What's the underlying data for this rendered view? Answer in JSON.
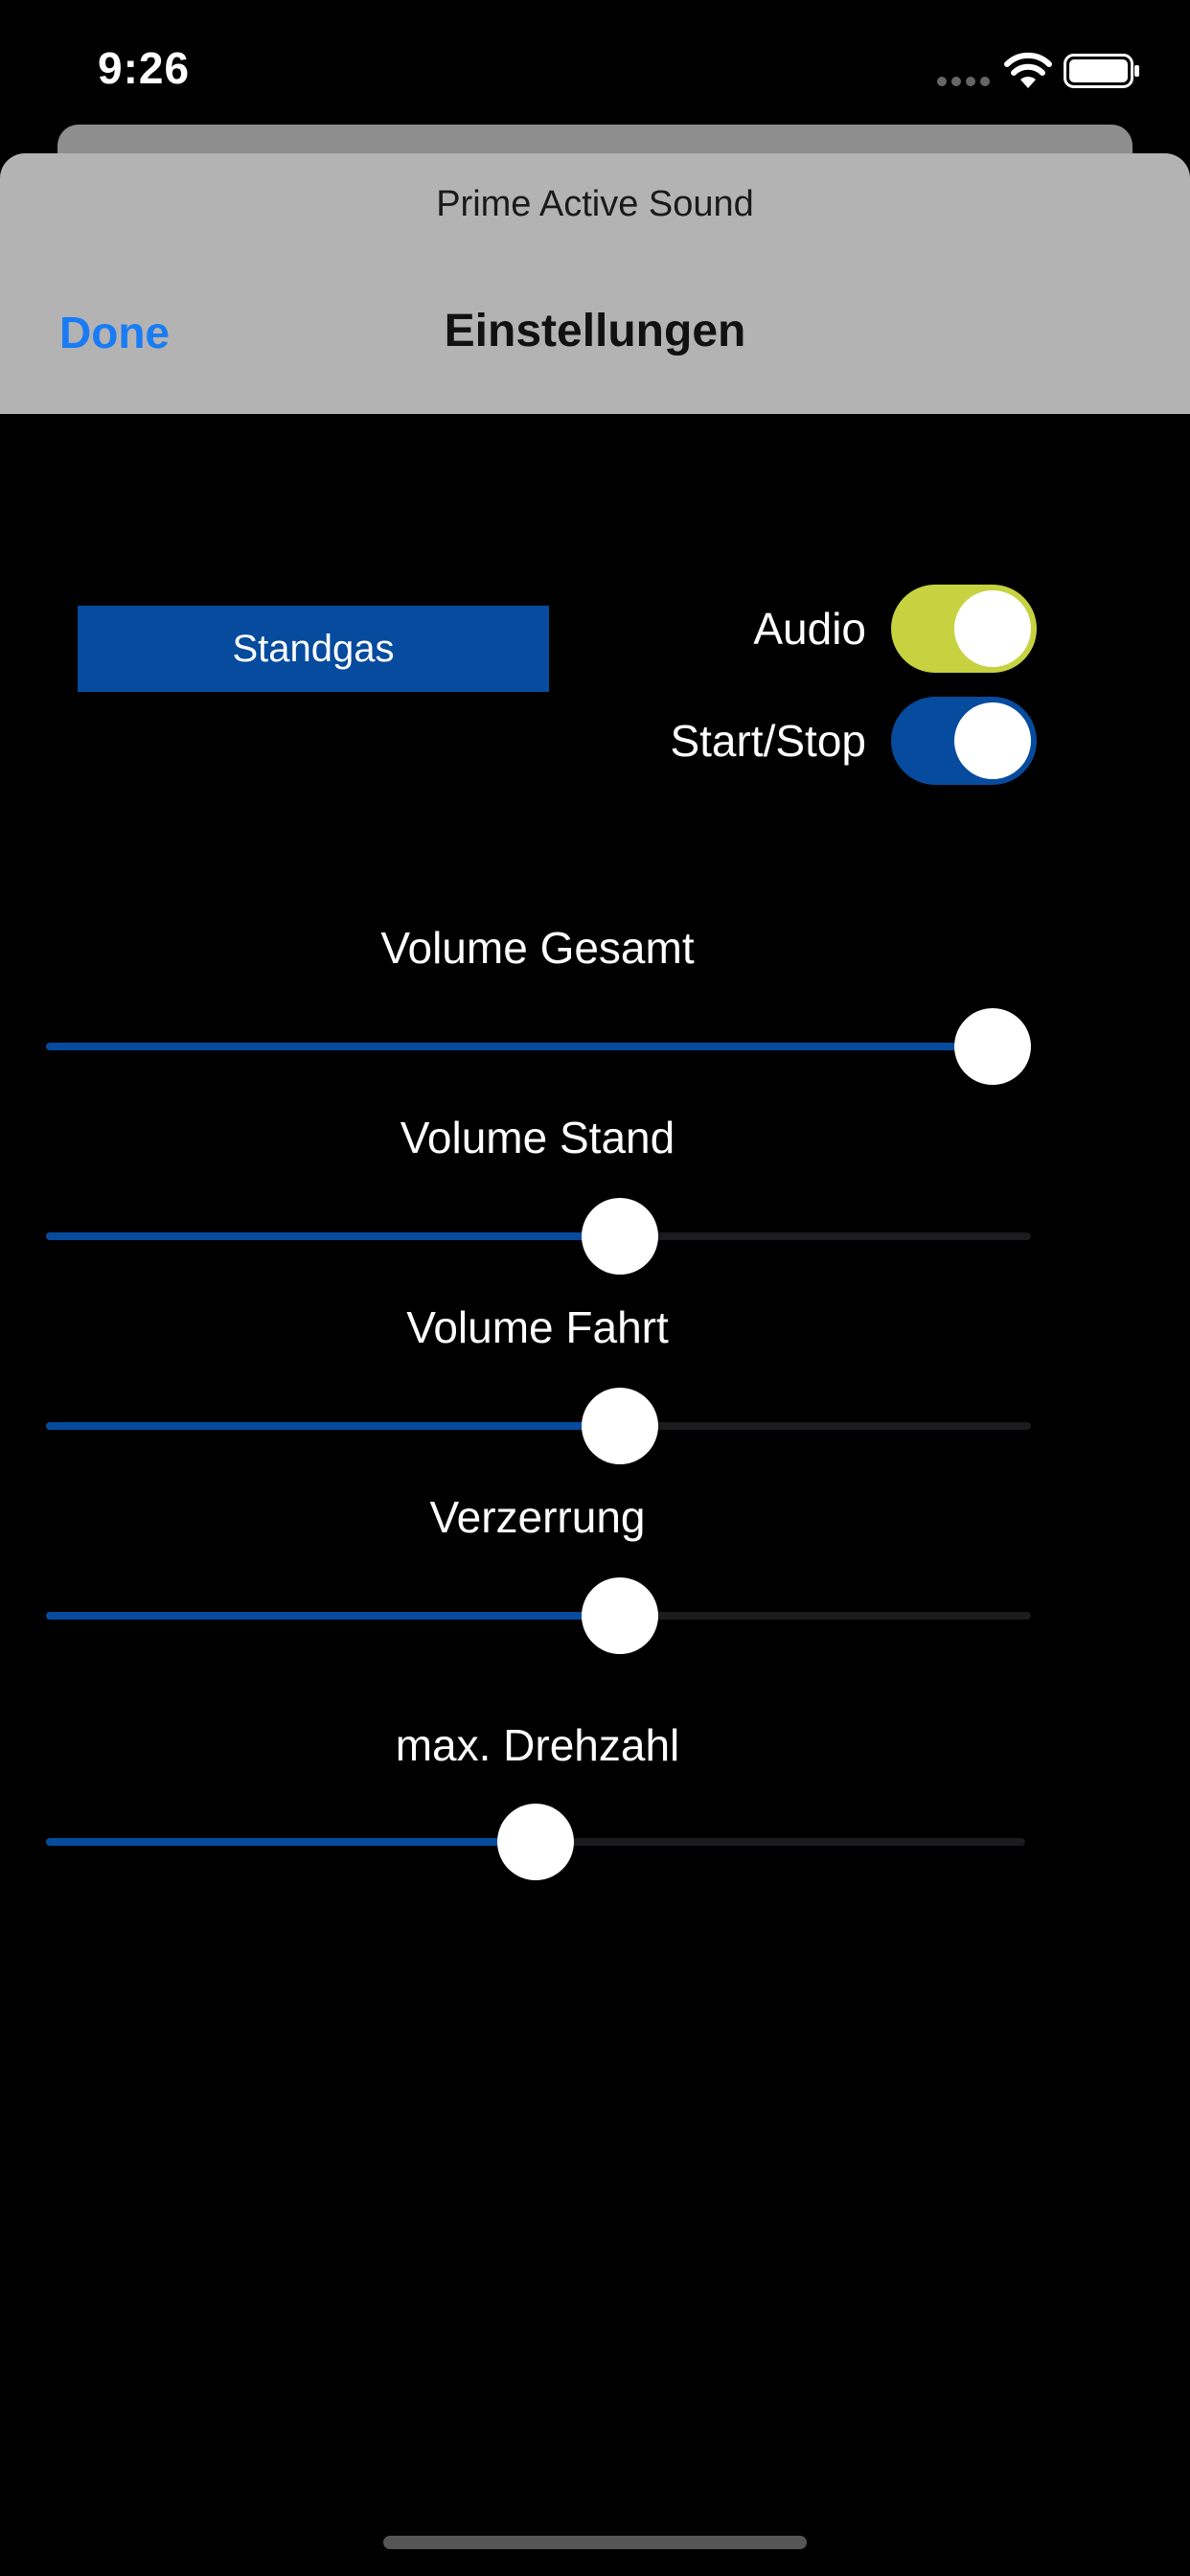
{
  "status_bar": {
    "time": "9:26"
  },
  "sheet": {
    "app_name": "Prime Active Sound",
    "title": "Einstellungen",
    "done_label": "Done"
  },
  "controls": {
    "standgas_label": "Standgas",
    "audio": {
      "label": "Audio",
      "on": true,
      "color": "#c6d240"
    },
    "startstop": {
      "label": "Start/Stop",
      "on": true,
      "color": "#064b9e"
    }
  },
  "sliders": [
    {
      "label": "Volume Gesamt",
      "value": 1.0
    },
    {
      "label": "Volume Stand",
      "value": 0.59
    },
    {
      "label": "Volume Fahrt",
      "value": 0.59
    },
    {
      "label": "Verzerrung",
      "value": 0.59
    },
    {
      "label": "max. Drehzahl",
      "value": 0.5
    }
  ],
  "colors": {
    "accent": "#064b9e",
    "done": "#1a7cf5",
    "audio_toggle": "#c6d240"
  }
}
